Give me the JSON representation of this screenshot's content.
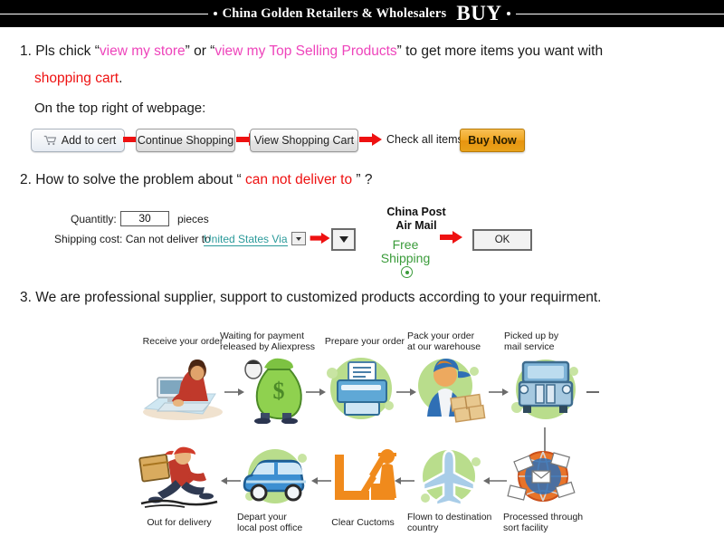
{
  "banner": {
    "title": "China Golden Retailers & Wholesalers",
    "buy": "BUY",
    "bg_color": "#000000",
    "text_color": "#ffffff"
  },
  "step1": {
    "number": "1.",
    "text_a": "Pls chick “",
    "link_store": "view my store",
    "text_b": "” or “",
    "link_top_selling": "view my Top Selling  Products",
    "text_c": "” to get more items you want with",
    "highlight": "shopping cart",
    "period": ".",
    "subtitle": "On the top right of webpage:",
    "link_color": "#ee44bb",
    "highlight_color": "#ee1111"
  },
  "buttons": {
    "add_to_cart": "Add to cert",
    "continue_shopping": "Continue Shopping",
    "view_shopping_cart": "View Shopping Cart",
    "check_all_items": "Check all items",
    "buy_now": "Buy Now",
    "buy_now_color": "#eda01a",
    "arrow_color": "#ee1111",
    "cart_icon": "shopping-cart-icon"
  },
  "step2": {
    "number": "2.",
    "text_a": "How to solve the problem about “ ",
    "highlight": "can not deliver to",
    "text_b": " ” ?",
    "highlight_color": "#ee1111",
    "form": {
      "quantity_label": "Quantitly:",
      "quantity_value": "30",
      "quantity_unit": "pieces",
      "shipping_label": "Shipping cost: Can not deliver to",
      "country_value": "United States Via",
      "country_color": "#2a9a9a",
      "dropdown_icon": "chevron-down-icon",
      "carrier_line1": "China Post",
      "carrier_line2": "Air Mail",
      "free_line1": "Free",
      "free_line2": "Shipping",
      "free_color": "#3a9b3a",
      "radio_icon": "radio-selected-icon",
      "ok_label": "OK",
      "arrow_color": "#ee1111"
    }
  },
  "step3": {
    "number": "3.",
    "text": "We are professional supplier, support to customized products according to your requirment."
  },
  "flowchart": {
    "top_row": [
      {
        "label": "Receive your order",
        "icon": "person-at-computer-icon"
      },
      {
        "label": "Waiting for payment\nreleased by Aliexpress",
        "label1": "Waiting for payment",
        "label2": "released by Aliexpress",
        "icon": "money-bag-icon"
      },
      {
        "label": "Prepare your order",
        "icon": "printer-icon"
      },
      {
        "label": "Pack your order\nat our warehouse",
        "label1": "Pack your order",
        "label2": "at our warehouse",
        "icon": "worker-packing-icon"
      },
      {
        "label": "Picked up by\nmail service",
        "label1": "Picked up by",
        "label2": "mail service",
        "icon": "delivery-truck-icon"
      }
    ],
    "bottom_row": [
      {
        "label": "Out for delivery",
        "icon": "running-courier-icon"
      },
      {
        "label": "Depart your\nlocal post office",
        "label1": "Depart your",
        "label2": "local post office",
        "icon": "delivery-van-icon"
      },
      {
        "label": "Clear Cuctoms",
        "icon": "customs-officer-icon"
      },
      {
        "label": "Flown to destination\ncountry",
        "label1": "Flown to destination",
        "label2": "country",
        "icon": "airplane-icon"
      },
      {
        "label": "Processed through\nsort facility",
        "label1": "Processed through",
        "label2": "sort facility",
        "icon": "mail-sorting-icon"
      }
    ],
    "blob_color": "#b9dd8c",
    "arrow_color": "#6b6b6b"
  }
}
